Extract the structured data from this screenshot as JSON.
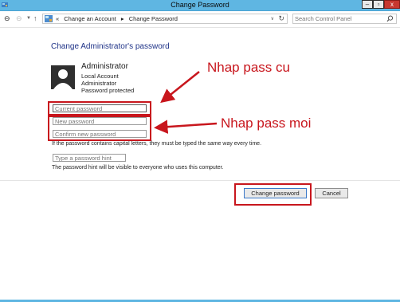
{
  "window": {
    "title": "Change Password",
    "controls": {
      "minimize": "–",
      "maximize": "▫",
      "close": "x"
    }
  },
  "addressbar": {
    "breadcrumb_overflow": "«",
    "crumbs": [
      "Change an Account",
      "Change Password"
    ],
    "separator": "▸",
    "search_placeholder": "Search Control Panel"
  },
  "main": {
    "heading": "Change Administrator's password",
    "account": {
      "name": "Administrator",
      "lines": [
        "Local Account",
        "Administrator",
        "Password protected"
      ]
    },
    "fields": {
      "current_placeholder": "Current password",
      "new_placeholder": "New password",
      "confirm_placeholder": "Confirm new password",
      "hint_placeholder": "Type a password hint"
    },
    "notes": {
      "case_note": "If the password contains capital letters, they must be typed the same way every time.",
      "hint_note": "The password hint will be visible to everyone who uses this computer."
    },
    "buttons": {
      "change": "Change password",
      "cancel": "Cancel"
    }
  },
  "annotations": {
    "old_pass": "Nhap pass cu",
    "new_pass": "Nhap pass moi",
    "color": "#c8161d"
  },
  "colors": {
    "titlebar": "#5fb6e2",
    "heading": "#1e3287",
    "highlight": "#c8161d"
  }
}
